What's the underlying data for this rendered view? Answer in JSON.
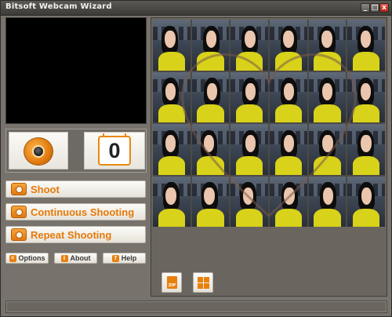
{
  "window": {
    "title": "Bitsoft Webcam Wizard",
    "controls": {
      "minimize": "_",
      "maximize": "□",
      "close": "x"
    }
  },
  "counter": {
    "value": "0"
  },
  "buttons": {
    "shoot": "Shoot",
    "continuous": "Continuous Shooting",
    "repeat": "Repeat Shooting",
    "options": "Options",
    "about": "About",
    "help": "Help"
  },
  "icons": {
    "camera": "webcam-eye-icon",
    "shoot": "camera-icon",
    "continuous": "camera-burst-icon",
    "repeat": "camera-repeat-icon",
    "options": "wrench-icon",
    "about": "info-icon",
    "help": "help-icon",
    "zip": "zip-archive-icon",
    "layout": "grid-layout-icon"
  },
  "gallery": {
    "columns": 6,
    "rows": 4,
    "thumbnails": 24,
    "overlay": "heart-outline"
  },
  "colors": {
    "accent": "#e57a09",
    "window_bg": "#77736c",
    "preview_bg": "#000000",
    "shirt": "#d8d21a"
  }
}
